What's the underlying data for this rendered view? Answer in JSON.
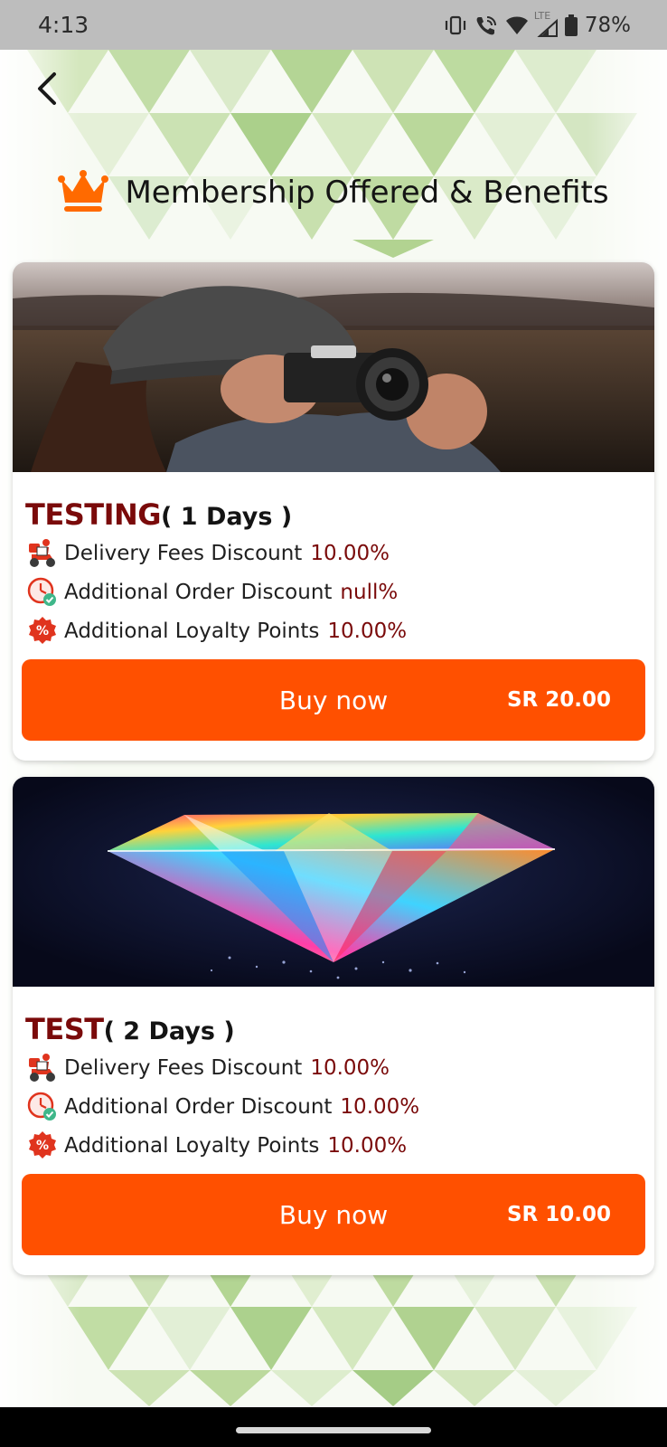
{
  "status_bar": {
    "time": "4:13",
    "network_label": "LTE",
    "battery": "78%"
  },
  "header": {
    "title": "Membership Offered & Benefits",
    "crown_color": "#ff6a00"
  },
  "colors": {
    "accent": "#ff5000",
    "plan_name": "#7a0a0a"
  },
  "plans": [
    {
      "name": "TESTING",
      "duration": "( 1 Days )",
      "image": "photographer-with-camera",
      "benefits": [
        {
          "icon": "delivery-scooter-icon",
          "label": "Delivery Fees Discount",
          "value": "10.00%"
        },
        {
          "icon": "clock-check-icon",
          "label": "Additional Order Discount",
          "value": "null%"
        },
        {
          "icon": "percent-badge-icon",
          "label": "Additional Loyalty Points",
          "value": "10.00%"
        }
      ],
      "button_label": "Buy now",
      "price": "SR 20.00"
    },
    {
      "name": "TEST",
      "duration": "( 2 Days )",
      "image": "rainbow-diamond",
      "benefits": [
        {
          "icon": "delivery-scooter-icon",
          "label": "Delivery Fees Discount",
          "value": "10.00%"
        },
        {
          "icon": "clock-check-icon",
          "label": "Additional Order Discount",
          "value": "10.00%"
        },
        {
          "icon": "percent-badge-icon",
          "label": "Additional Loyalty Points",
          "value": "10.00%"
        }
      ],
      "button_label": "Buy now",
      "price": "SR 10.00"
    }
  ]
}
